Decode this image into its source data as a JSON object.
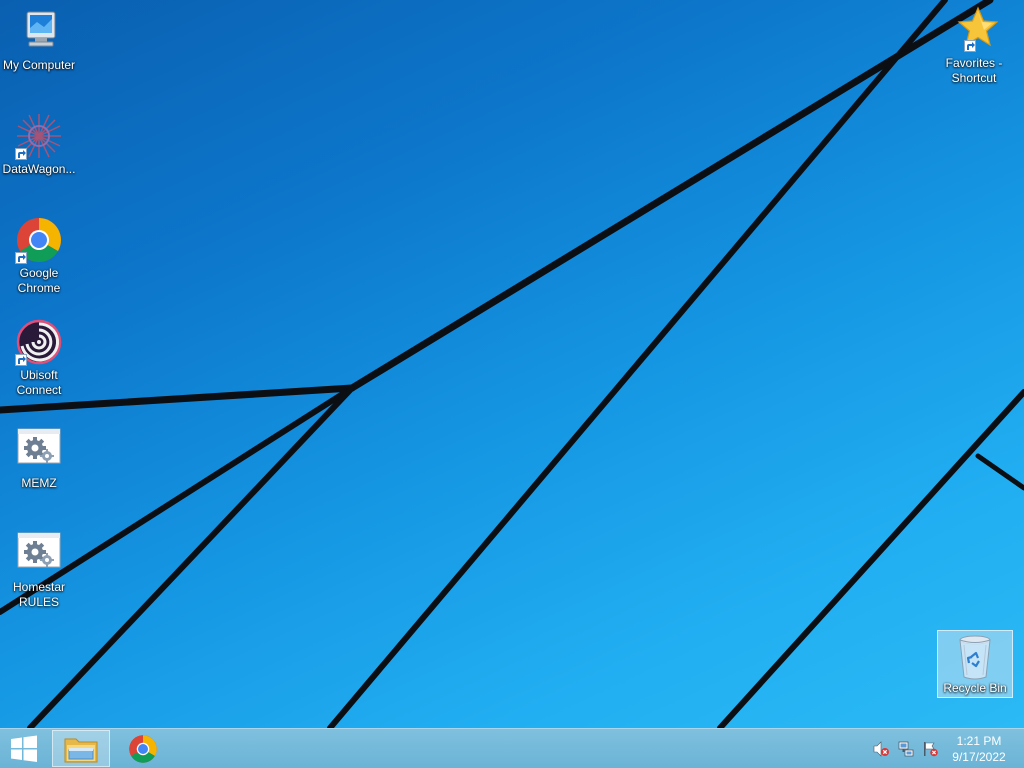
{
  "desktop": {
    "icons": [
      {
        "label": "My Computer",
        "icon": "computer-icon"
      },
      {
        "label": "DataWagon...",
        "icon": "datawagon-icon"
      },
      {
        "label": "Google Chrome",
        "icon": "chrome-icon"
      },
      {
        "label": "Ubisoft Connect",
        "icon": "ubisoft-icon"
      },
      {
        "label": "MEMZ",
        "icon": "settings-gear-icon"
      },
      {
        "label": "Homestar RULES",
        "icon": "settings-gear-icon"
      },
      {
        "label": "Favorites - Shortcut",
        "icon": "star-icon"
      },
      {
        "label": "Recycle Bin",
        "icon": "recycle-bin-icon"
      }
    ]
  },
  "taskbar": {
    "start_icon": "windows-logo-icon",
    "pinned": [
      {
        "name": "File Explorer",
        "icon": "file-explorer-icon",
        "active": true
      },
      {
        "name": "Google Chrome",
        "icon": "chrome-icon",
        "active": false
      }
    ],
    "tray": {
      "icons": [
        "volume-muted-icon",
        "network-icon",
        "action-center-flag-icon"
      ],
      "time": "1:21 PM",
      "date": "9/17/2022"
    }
  },
  "colors": {
    "wallpaper": "#1596e2",
    "taskbar": "#6bb3d6"
  }
}
